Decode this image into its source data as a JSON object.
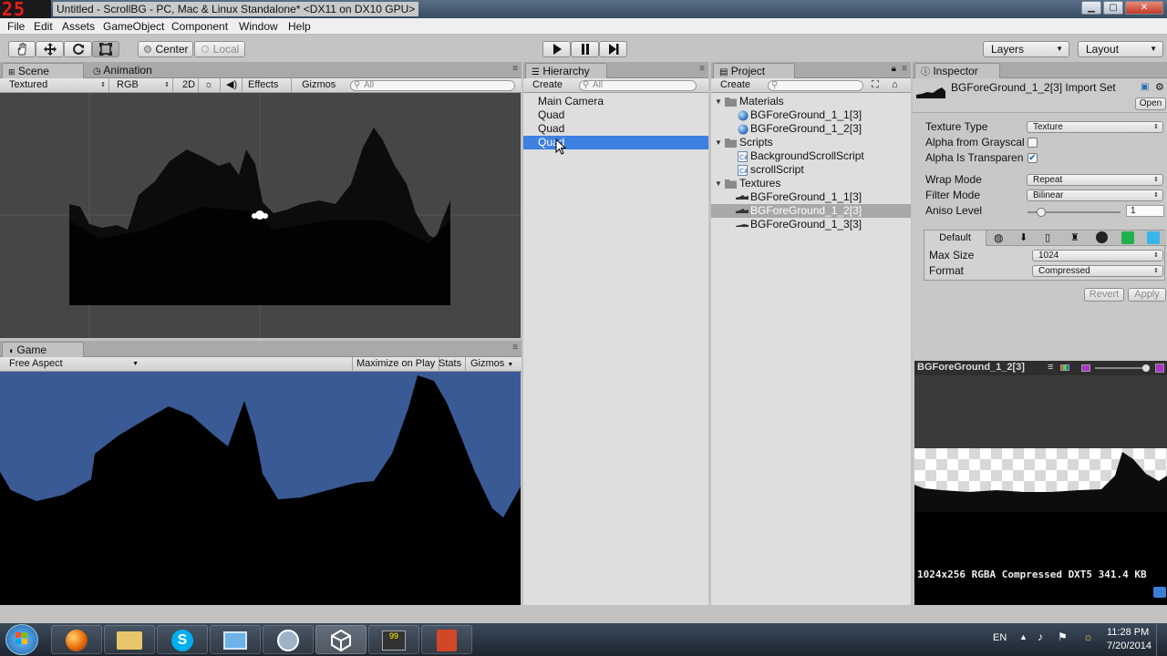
{
  "window": {
    "logo": "25",
    "title": "Untitled - ScrollBG - PC, Mac & Linux Standalone* <DX11 on DX10 GPU>",
    "min": "▁",
    "max": "▢",
    "close": "✕"
  },
  "menu": [
    "File",
    "Edit",
    "Assets",
    "GameObject",
    "Component",
    "Window",
    "Help"
  ],
  "toolbar": {
    "pivot_center": "Center",
    "pivot_local": "Local",
    "layers": "Layers",
    "layout": "Layout"
  },
  "scene": {
    "tab_scene": "Scene",
    "tab_animation": "Animation",
    "render_mode": "Textured",
    "color_mode": "RGB",
    "mode_2d": "2D",
    "effects": "Effects",
    "gizmos": "Gizmos",
    "search_placeholder": "All"
  },
  "game": {
    "tab": "Game",
    "aspect": "Free Aspect",
    "maximize": "Maximize on Play",
    "stats": "Stats",
    "gizmos": "Gizmos",
    "sky_color": "#3a5a95"
  },
  "hierarchy": {
    "tab": "Hierarchy",
    "create": "Create",
    "search_placeholder": "All",
    "items": [
      "Main Camera",
      "Quad",
      "Quad",
      "Quad"
    ]
  },
  "project": {
    "tab": "Project",
    "create": "Create",
    "folders": [
      {
        "name": "Materials",
        "items": [
          "BGForeGround_1_1[3]",
          "BGForeGround_1_2[3]"
        ]
      },
      {
        "name": "Scripts",
        "items": [
          "BackgroundScrollScript",
          "scrollScript"
        ]
      },
      {
        "name": "Textures",
        "items": [
          "BGForeGround_1_1[3]",
          "BGForeGround_1_2[3]",
          "BGForeGround_1_3[3]"
        ]
      }
    ]
  },
  "inspector": {
    "tab": "Inspector",
    "asset_title": "BGForeGround_1_2[3] Import Set",
    "open": "Open",
    "fields": [
      {
        "label": "Texture Type",
        "value": "Texture"
      },
      {
        "label": "Alpha from Grayscal",
        "checked": false
      },
      {
        "label": "Alpha Is Transparen",
        "checked": true
      },
      {
        "label": "Wrap Mode",
        "value": "Repeat"
      },
      {
        "label": "Filter Mode",
        "value": "Bilinear"
      },
      {
        "label": "Aniso Level",
        "value": "1"
      }
    ],
    "platform_default": "Default",
    "max_size_label": "Max Size",
    "max_size": "1024",
    "format_label": "Format",
    "format": "Compressed",
    "revert": "Revert",
    "apply": "Apply",
    "preview_title": "BGForeGround_1_2[3]",
    "preview_info": "1024x256  RGBA Compressed DXT5   341.4 KB"
  },
  "taskbar": {
    "lang": "EN",
    "time": "11:28 PM",
    "date": "7/20/2014"
  }
}
